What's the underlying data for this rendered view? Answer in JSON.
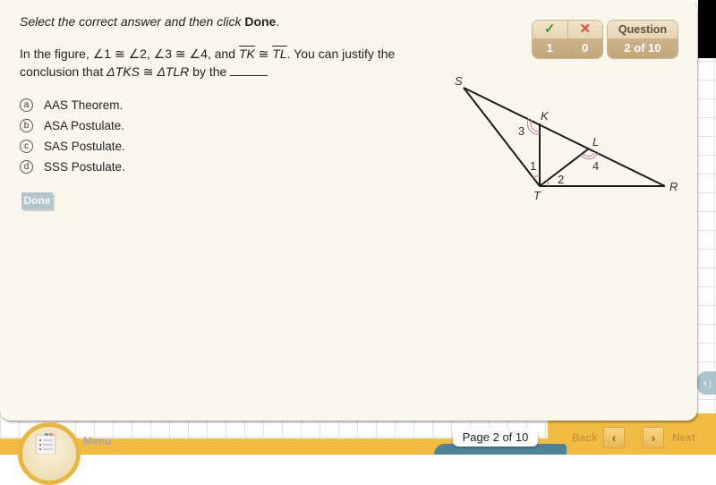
{
  "instruction": {
    "prefix": "Select the correct answer and then click ",
    "bold": "Done",
    "suffix": "."
  },
  "question": {
    "part1": "In the figure, ∠1 ≅ ∠2, ∠3 ≅ ∠4, and ",
    "seg1": "TK",
    "cong": " ≅ ",
    "seg2": "TL",
    "part2": ". You can justify the conclusion that ",
    "tri1": "ΔTKS",
    "cong2": " ≅ ",
    "tri2": "ΔTLR",
    "part3": " by the "
  },
  "options": [
    {
      "letter": "a",
      "label": "AAS Theorem."
    },
    {
      "letter": "b",
      "label": "ASA Postulate."
    },
    {
      "letter": "c",
      "label": "SAS Postulate."
    },
    {
      "letter": "d",
      "label": "SSS Postulate."
    }
  ],
  "done_button": "Done",
  "score": {
    "correct_icon": "✓",
    "incorrect_icon": "✕",
    "correct": "1",
    "incorrect": "0"
  },
  "question_counter": {
    "label": "Question",
    "value": "2 of 10"
  },
  "figure": {
    "points": {
      "S": "S",
      "K": "K",
      "L": "L",
      "T": "T",
      "R": "R"
    },
    "angles": {
      "a1": "1",
      "a2": "2",
      "a3": "3",
      "a4": "4"
    },
    "line_color": "#1a1a1a",
    "arc_color": "#c98aa8"
  },
  "footer": {
    "menu_label": "Menu",
    "page_indicator": "Page  2 of 10",
    "back_label": "Back",
    "next_label": "Next",
    "back_icon": "‹",
    "next_icon": "›",
    "audio_icon": "◖)"
  }
}
